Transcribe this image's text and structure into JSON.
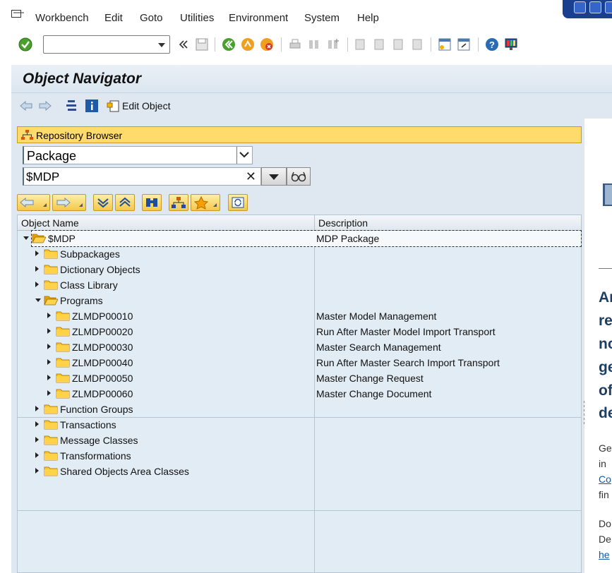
{
  "menu": {
    "items": [
      "Workbench",
      "Edit",
      "Goto",
      "Utilities",
      "Environment",
      "System",
      "Help"
    ]
  },
  "toolbar": {
    "command_field_value": ""
  },
  "page": {
    "title": "Object Navigator",
    "edit_object_label": "Edit Object"
  },
  "repository": {
    "header": "Repository Browser",
    "object_type": "Package",
    "object_name": "$MDP",
    "clear_glyph": "✕"
  },
  "tree": {
    "columns": [
      "Object Name",
      "Description"
    ],
    "rows": [
      {
        "name": "$MDP",
        "desc": "MDP Package",
        "level": 0,
        "open": true
      },
      {
        "name": "Subpackages",
        "desc": "",
        "level": 1,
        "open": false
      },
      {
        "name": "Dictionary Objects",
        "desc": "",
        "level": 1,
        "open": false
      },
      {
        "name": "Class Library",
        "desc": "",
        "level": 1,
        "open": false
      },
      {
        "name": "Programs",
        "desc": "",
        "level": 1,
        "open": true
      },
      {
        "name": "ZLMDP00010",
        "desc": "Master Model Management",
        "level": 2,
        "open": false
      },
      {
        "name": "ZLMDP00020",
        "desc": "Run After Master Model Import Transport",
        "level": 2,
        "open": false
      },
      {
        "name": "ZLMDP00030",
        "desc": "Master Search Management",
        "level": 2,
        "open": false
      },
      {
        "name": "ZLMDP00040",
        "desc": "Run After Master Search Import Transport",
        "level": 2,
        "open": false
      },
      {
        "name": "ZLMDP00050",
        "desc": "Master Change Request",
        "level": 2,
        "open": false
      },
      {
        "name": "ZLMDP00060",
        "desc": "Master Change Document",
        "level": 2,
        "open": false
      },
      {
        "name": "Function Groups",
        "desc": "",
        "level": 1,
        "open": false
      },
      {
        "name": "Transactions",
        "desc": "",
        "level": 1,
        "open": false
      },
      {
        "name": "Message Classes",
        "desc": "",
        "level": 1,
        "open": false
      },
      {
        "name": "Transformations",
        "desc": "",
        "level": 1,
        "open": false
      },
      {
        "name": "Shared Objects Area Classes",
        "desc": "",
        "level": 1,
        "open": false
      }
    ]
  },
  "right_pane": {
    "big_lines": [
      "Ar",
      "re",
      "no",
      "ge",
      "of",
      "de"
    ],
    "small_lines": [
      "Ge",
      "in"
    ],
    "link_1": "Co",
    "small_after_link": "fin",
    "small_lines_2": [
      "Do",
      "De"
    ],
    "link_2": "he"
  },
  "colors": {
    "header_yellow": "#fedb6a",
    "tree_bg": "#e2ecf5",
    "title_text": "#1d3f64",
    "link": "#0a5aa8"
  }
}
